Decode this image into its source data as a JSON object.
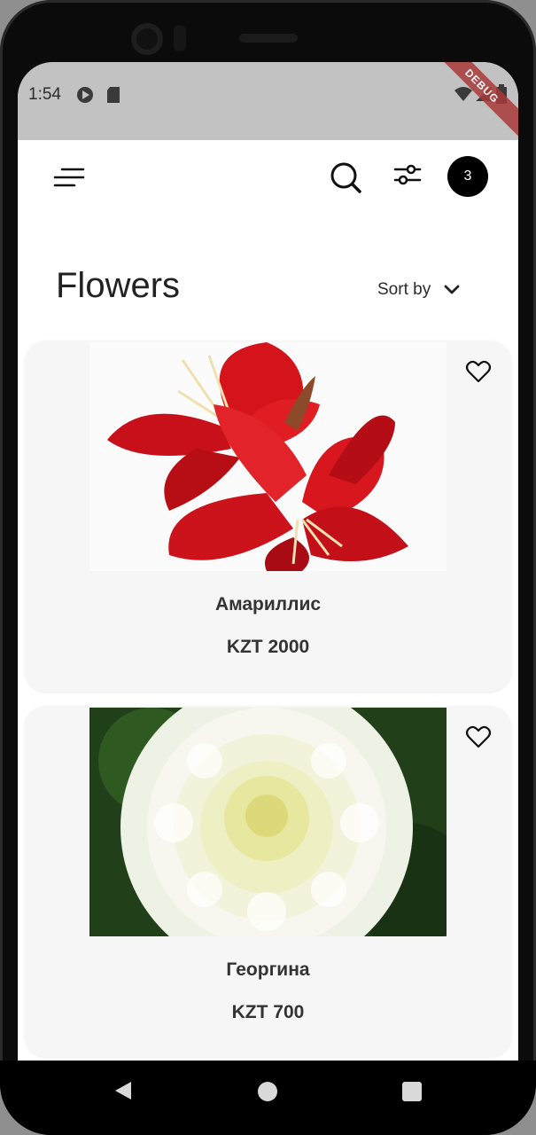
{
  "status_bar": {
    "time": "1:54",
    "icons": [
      "play-protect-icon",
      "sd-card-icon",
      "wifi-icon",
      "signal-icon",
      "battery-icon"
    ],
    "debug_label": "DEBUG"
  },
  "app_bar": {
    "menu_icon": "menu-icon",
    "search_icon": "search-icon",
    "filter_icon": "filter-icon",
    "cart_count": "3"
  },
  "header": {
    "title": "Flowers",
    "sort_label": "Sort by",
    "sort_icon": "chevron-down-icon"
  },
  "products": [
    {
      "name": "Амариллис",
      "price": "KZT 2000",
      "image": "red amaryllis flower",
      "favorite": false
    },
    {
      "name": "Георгина",
      "price": "KZT 700",
      "image": "white dahlia flower",
      "favorite": false
    }
  ],
  "nav_bar": {
    "back_icon": "back-triangle-icon",
    "home_icon": "home-circle-icon",
    "recents_icon": "recents-square-icon"
  },
  "colors": {
    "status_bar_bg": "#c2c2c2",
    "card_bg": "#f6f6f6",
    "badge_bg": "#000000",
    "text_primary": "#222222"
  }
}
